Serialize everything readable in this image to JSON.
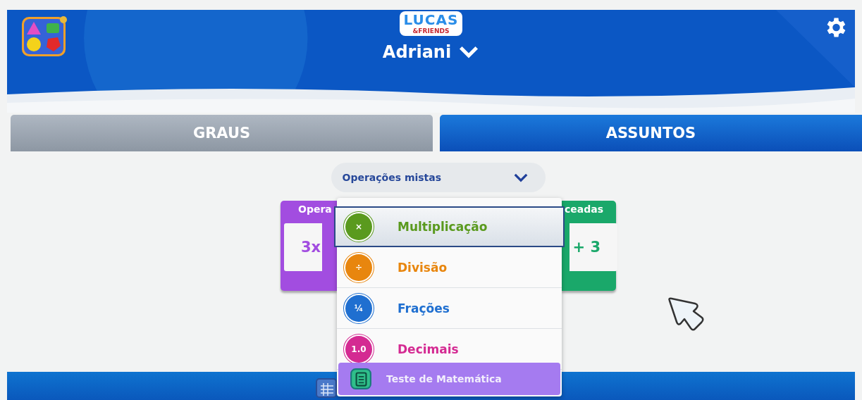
{
  "header": {
    "logo": {
      "line_1": "LUCAS",
      "line_2": "&FRIENDS"
    },
    "user": "Adriani"
  },
  "tabs": [
    {
      "label": "GRAUS",
      "selected": false
    },
    {
      "label": "ASSUNTOS",
      "selected": true
    }
  ],
  "dropdown": {
    "value": "Operações mistas",
    "expanded": true
  },
  "cards": [
    {
      "title": "Opera",
      "example": "3x",
      "color": "#a24de0"
    },
    {
      "title": "ceadas",
      "example": "+ 3",
      "color": "#1aa86a"
    }
  ],
  "menu": [
    {
      "kind": "topic",
      "label": "Multiplicação",
      "symbol": "×",
      "color": "#5a9a1e",
      "selected": true
    },
    {
      "kind": "topic",
      "label": "Divisão",
      "symbol": "÷",
      "color": "#e8860e",
      "selected": false
    },
    {
      "kind": "topic",
      "label": "Frações",
      "symbol": "¼",
      "color": "#1f6fd0",
      "selected": false
    },
    {
      "kind": "topic",
      "label": "Decimais",
      "symbol": "1.0",
      "color": "#d42a92",
      "selected": false
    },
    {
      "kind": "test",
      "label": "Teste de Matemática",
      "color": "#a57bf0",
      "selected": false
    }
  ]
}
